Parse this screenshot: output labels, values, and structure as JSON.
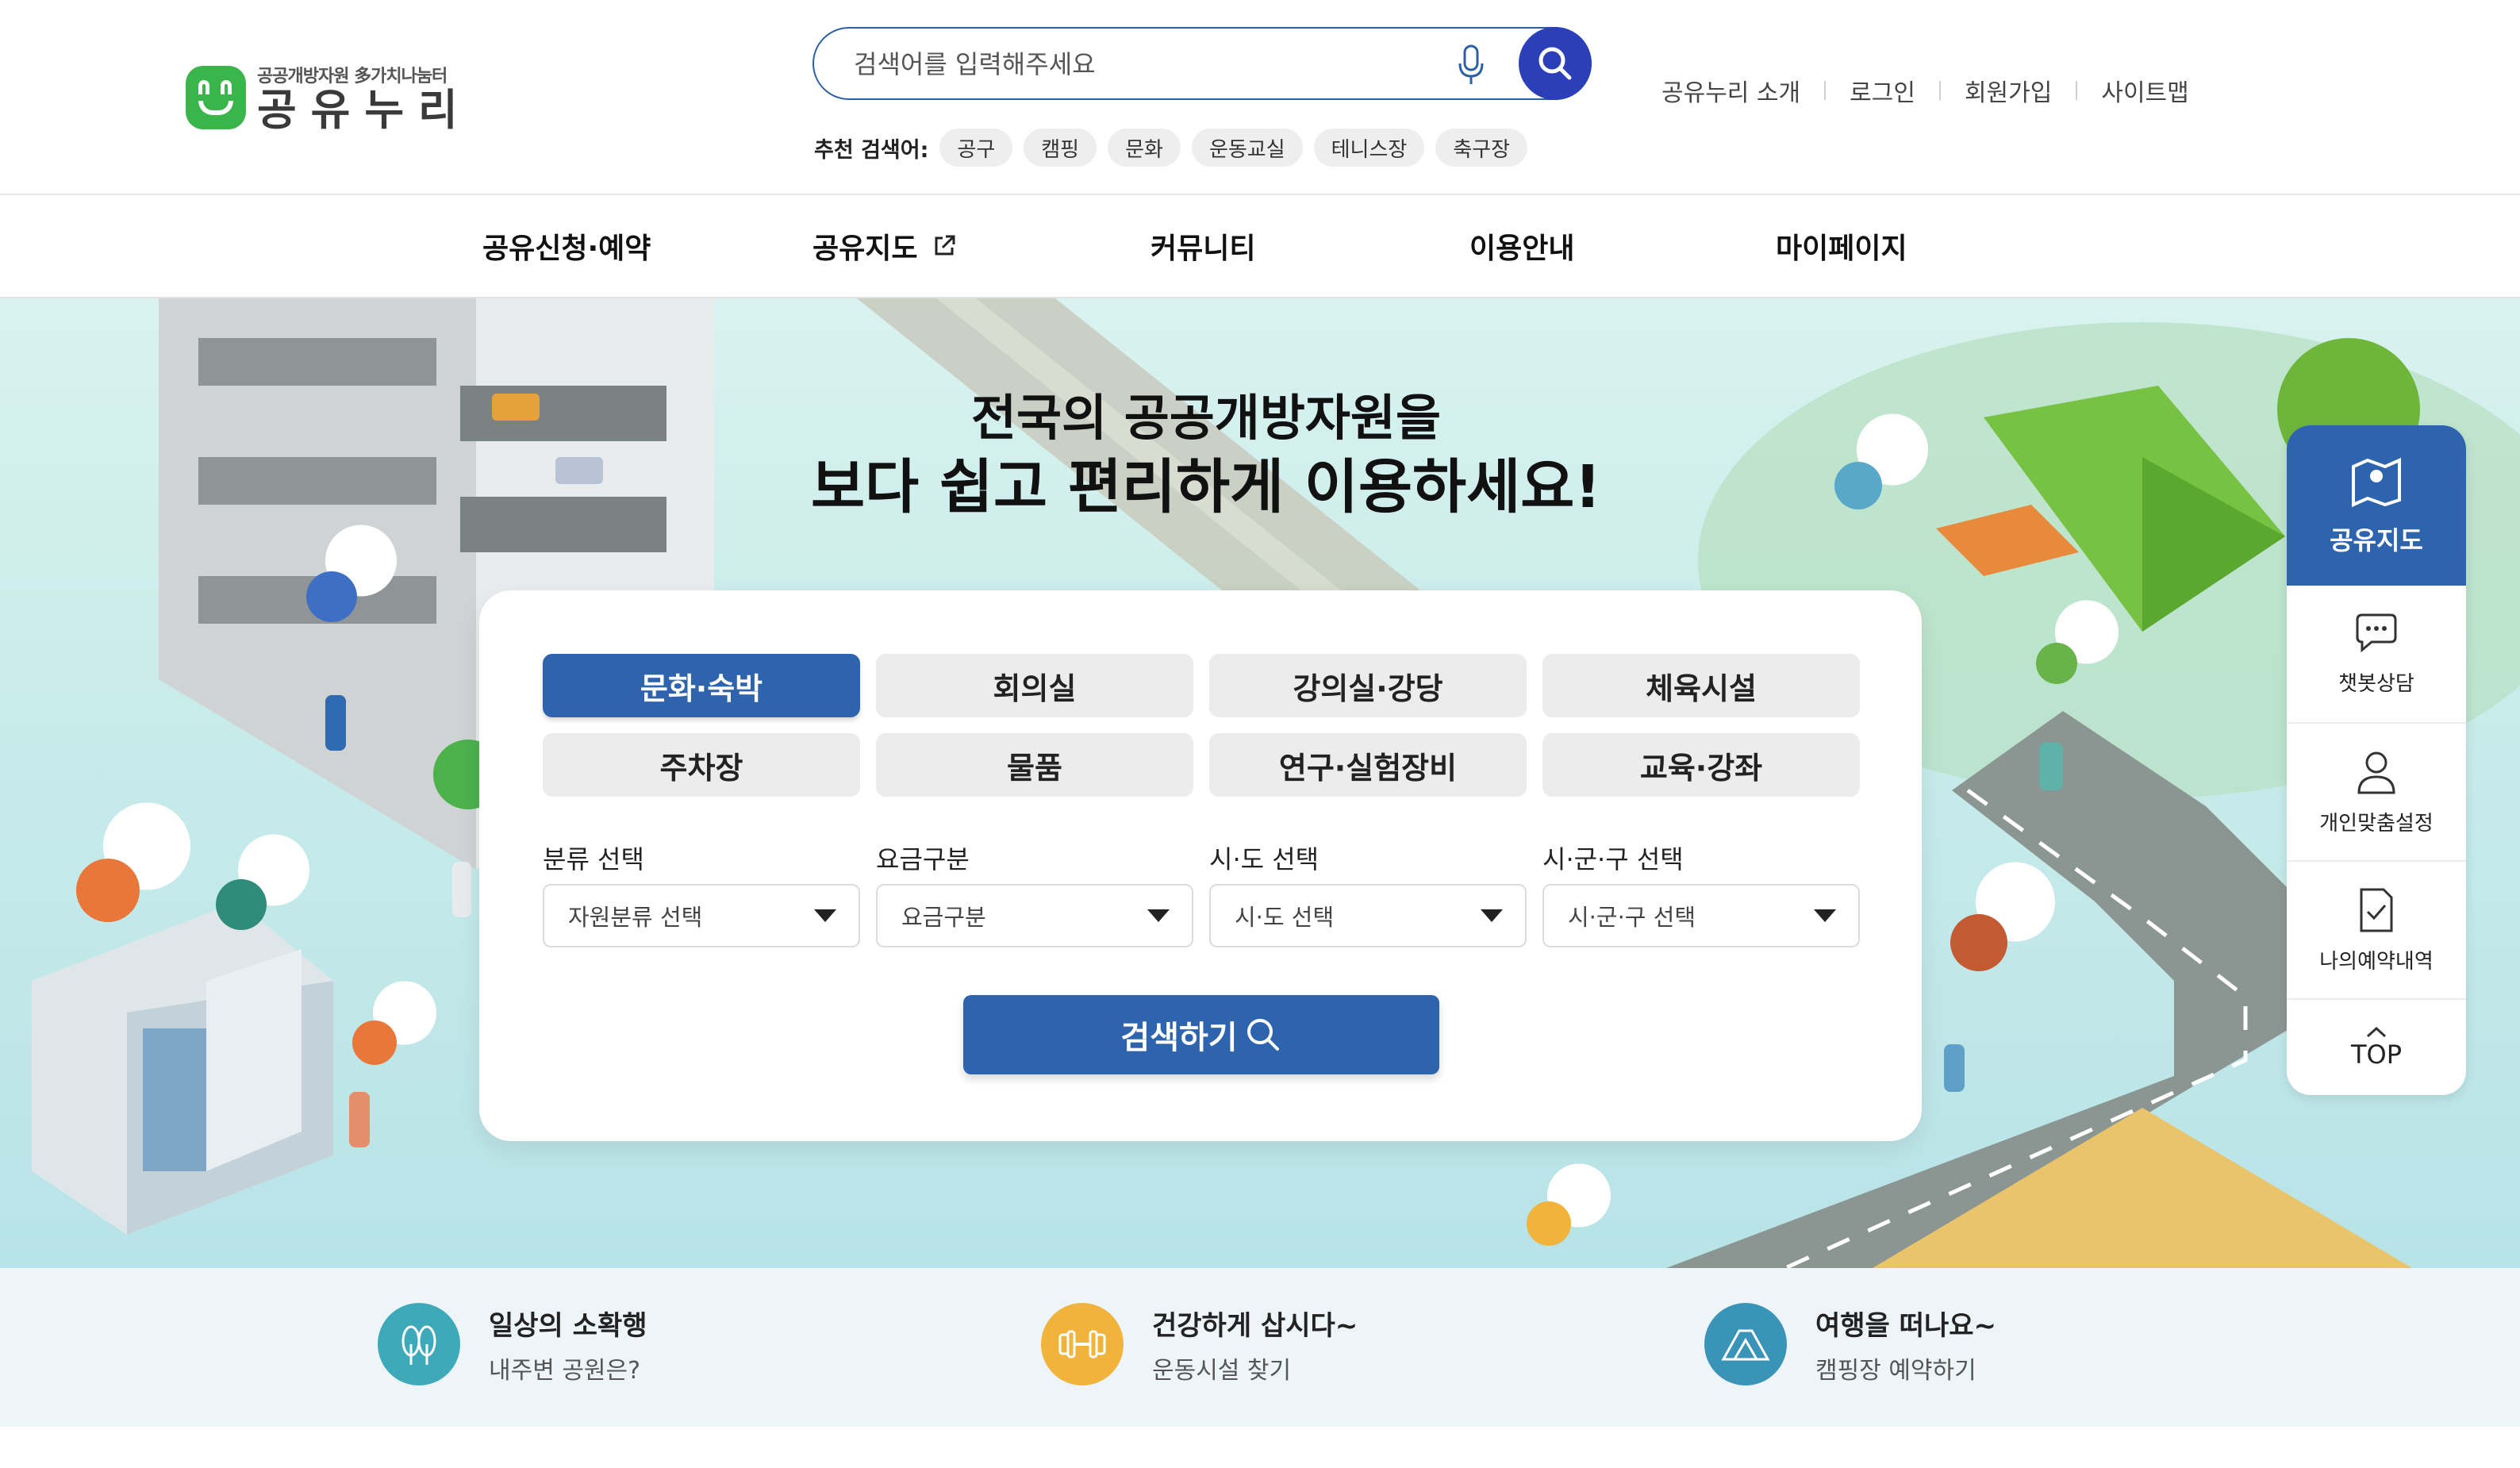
{
  "header": {
    "logo_sub": "공공개방자원 多가치나눔터",
    "logo_main": "공유누리",
    "search_placeholder": "검색어를 입력해주세요",
    "recommend_label": "추천 검색어:",
    "recommend_keywords": [
      "공구",
      "캠핑",
      "문화",
      "운동교실",
      "테니스장",
      "축구장"
    ],
    "util_links": [
      "공유누리 소개",
      "로그인",
      "회원가입",
      "사이트맵"
    ]
  },
  "gnb": {
    "items": [
      "공유신청·예약",
      "공유지도",
      "커뮤니티",
      "이용안내",
      "마이페이지"
    ]
  },
  "hero": {
    "title_line1": "전국의 공공개방자원을",
    "title_line2": "보다 쉽고 편리하게 이용하세요!",
    "categories": [
      "문화·숙박",
      "회의실",
      "강의실·강당",
      "체육시설",
      "주차장",
      "물품",
      "연구·실험장비",
      "교육·강좌"
    ],
    "active_category": "문화·숙박",
    "filters": [
      {
        "label": "분류 선택",
        "value": "자원분류 선택"
      },
      {
        "label": "요금구분",
        "value": "요금구분"
      },
      {
        "label": "시·도 선택",
        "value": "시·도 선택"
      },
      {
        "label": "시·군·구 선택",
        "value": "시·군·구 선택"
      }
    ],
    "submit_label": "검색하기"
  },
  "quick_menu": {
    "items": [
      {
        "label": "공유지도",
        "icon": "map-icon"
      },
      {
        "label": "챗봇상담",
        "icon": "chat-icon"
      },
      {
        "label": "개인맞춤설정",
        "icon": "user-icon"
      },
      {
        "label": "나의예약내역",
        "icon": "checklist-icon"
      }
    ],
    "top_label": "TOP"
  },
  "promos": [
    {
      "title": "일상의 소확행",
      "subtitle": "내주변 공원은?",
      "icon": "park-icon",
      "color": "#3ea9b8"
    },
    {
      "title": "건강하게 삽시다~",
      "subtitle": "운동시설 찾기",
      "icon": "dumbbell-icon",
      "color": "#f0b43c"
    },
    {
      "title": "여행을 떠나요~",
      "subtitle": "캠핑장 예약하기",
      "icon": "tent-icon",
      "color": "#3a94b8"
    }
  ],
  "colors": {
    "primary": "#2e64ad",
    "search_button": "#2b3fb8",
    "logo_green": "#3ab54a",
    "hero_bg": "#c9ecea",
    "bottom_bg": "#eef5f9"
  }
}
